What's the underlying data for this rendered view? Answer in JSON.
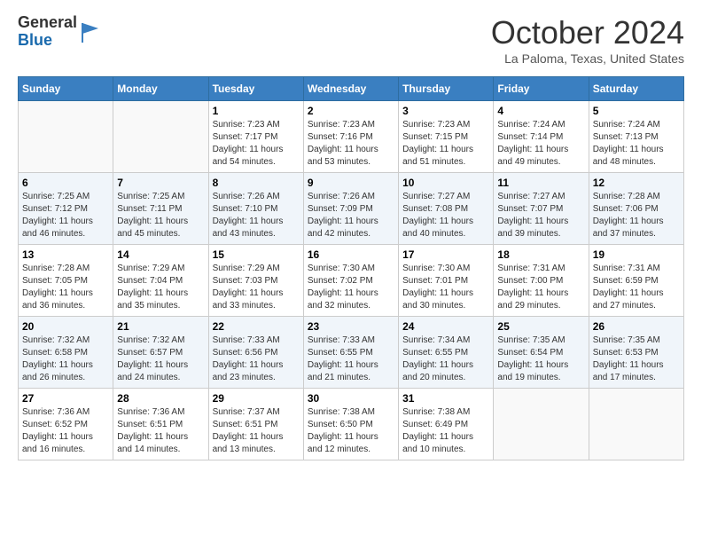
{
  "header": {
    "logo_general": "General",
    "logo_blue": "Blue",
    "month_title": "October 2024",
    "location": "La Paloma, Texas, United States"
  },
  "weekdays": [
    "Sunday",
    "Monday",
    "Tuesday",
    "Wednesday",
    "Thursday",
    "Friday",
    "Saturday"
  ],
  "weeks": [
    [
      {
        "day": "",
        "sunrise": "",
        "sunset": "",
        "daylight": ""
      },
      {
        "day": "",
        "sunrise": "",
        "sunset": "",
        "daylight": ""
      },
      {
        "day": "1",
        "sunrise": "Sunrise: 7:23 AM",
        "sunset": "Sunset: 7:17 PM",
        "daylight": "Daylight: 11 hours and 54 minutes."
      },
      {
        "day": "2",
        "sunrise": "Sunrise: 7:23 AM",
        "sunset": "Sunset: 7:16 PM",
        "daylight": "Daylight: 11 hours and 53 minutes."
      },
      {
        "day": "3",
        "sunrise": "Sunrise: 7:23 AM",
        "sunset": "Sunset: 7:15 PM",
        "daylight": "Daylight: 11 hours and 51 minutes."
      },
      {
        "day": "4",
        "sunrise": "Sunrise: 7:24 AM",
        "sunset": "Sunset: 7:14 PM",
        "daylight": "Daylight: 11 hours and 49 minutes."
      },
      {
        "day": "5",
        "sunrise": "Sunrise: 7:24 AM",
        "sunset": "Sunset: 7:13 PM",
        "daylight": "Daylight: 11 hours and 48 minutes."
      }
    ],
    [
      {
        "day": "6",
        "sunrise": "Sunrise: 7:25 AM",
        "sunset": "Sunset: 7:12 PM",
        "daylight": "Daylight: 11 hours and 46 minutes."
      },
      {
        "day": "7",
        "sunrise": "Sunrise: 7:25 AM",
        "sunset": "Sunset: 7:11 PM",
        "daylight": "Daylight: 11 hours and 45 minutes."
      },
      {
        "day": "8",
        "sunrise": "Sunrise: 7:26 AM",
        "sunset": "Sunset: 7:10 PM",
        "daylight": "Daylight: 11 hours and 43 minutes."
      },
      {
        "day": "9",
        "sunrise": "Sunrise: 7:26 AM",
        "sunset": "Sunset: 7:09 PM",
        "daylight": "Daylight: 11 hours and 42 minutes."
      },
      {
        "day": "10",
        "sunrise": "Sunrise: 7:27 AM",
        "sunset": "Sunset: 7:08 PM",
        "daylight": "Daylight: 11 hours and 40 minutes."
      },
      {
        "day": "11",
        "sunrise": "Sunrise: 7:27 AM",
        "sunset": "Sunset: 7:07 PM",
        "daylight": "Daylight: 11 hours and 39 minutes."
      },
      {
        "day": "12",
        "sunrise": "Sunrise: 7:28 AM",
        "sunset": "Sunset: 7:06 PM",
        "daylight": "Daylight: 11 hours and 37 minutes."
      }
    ],
    [
      {
        "day": "13",
        "sunrise": "Sunrise: 7:28 AM",
        "sunset": "Sunset: 7:05 PM",
        "daylight": "Daylight: 11 hours and 36 minutes."
      },
      {
        "day": "14",
        "sunrise": "Sunrise: 7:29 AM",
        "sunset": "Sunset: 7:04 PM",
        "daylight": "Daylight: 11 hours and 35 minutes."
      },
      {
        "day": "15",
        "sunrise": "Sunrise: 7:29 AM",
        "sunset": "Sunset: 7:03 PM",
        "daylight": "Daylight: 11 hours and 33 minutes."
      },
      {
        "day": "16",
        "sunrise": "Sunrise: 7:30 AM",
        "sunset": "Sunset: 7:02 PM",
        "daylight": "Daylight: 11 hours and 32 minutes."
      },
      {
        "day": "17",
        "sunrise": "Sunrise: 7:30 AM",
        "sunset": "Sunset: 7:01 PM",
        "daylight": "Daylight: 11 hours and 30 minutes."
      },
      {
        "day": "18",
        "sunrise": "Sunrise: 7:31 AM",
        "sunset": "Sunset: 7:00 PM",
        "daylight": "Daylight: 11 hours and 29 minutes."
      },
      {
        "day": "19",
        "sunrise": "Sunrise: 7:31 AM",
        "sunset": "Sunset: 6:59 PM",
        "daylight": "Daylight: 11 hours and 27 minutes."
      }
    ],
    [
      {
        "day": "20",
        "sunrise": "Sunrise: 7:32 AM",
        "sunset": "Sunset: 6:58 PM",
        "daylight": "Daylight: 11 hours and 26 minutes."
      },
      {
        "day": "21",
        "sunrise": "Sunrise: 7:32 AM",
        "sunset": "Sunset: 6:57 PM",
        "daylight": "Daylight: 11 hours and 24 minutes."
      },
      {
        "day": "22",
        "sunrise": "Sunrise: 7:33 AM",
        "sunset": "Sunset: 6:56 PM",
        "daylight": "Daylight: 11 hours and 23 minutes."
      },
      {
        "day": "23",
        "sunrise": "Sunrise: 7:33 AM",
        "sunset": "Sunset: 6:55 PM",
        "daylight": "Daylight: 11 hours and 21 minutes."
      },
      {
        "day": "24",
        "sunrise": "Sunrise: 7:34 AM",
        "sunset": "Sunset: 6:55 PM",
        "daylight": "Daylight: 11 hours and 20 minutes."
      },
      {
        "day": "25",
        "sunrise": "Sunrise: 7:35 AM",
        "sunset": "Sunset: 6:54 PM",
        "daylight": "Daylight: 11 hours and 19 minutes."
      },
      {
        "day": "26",
        "sunrise": "Sunrise: 7:35 AM",
        "sunset": "Sunset: 6:53 PM",
        "daylight": "Daylight: 11 hours and 17 minutes."
      }
    ],
    [
      {
        "day": "27",
        "sunrise": "Sunrise: 7:36 AM",
        "sunset": "Sunset: 6:52 PM",
        "daylight": "Daylight: 11 hours and 16 minutes."
      },
      {
        "day": "28",
        "sunrise": "Sunrise: 7:36 AM",
        "sunset": "Sunset: 6:51 PM",
        "daylight": "Daylight: 11 hours and 14 minutes."
      },
      {
        "day": "29",
        "sunrise": "Sunrise: 7:37 AM",
        "sunset": "Sunset: 6:51 PM",
        "daylight": "Daylight: 11 hours and 13 minutes."
      },
      {
        "day": "30",
        "sunrise": "Sunrise: 7:38 AM",
        "sunset": "Sunset: 6:50 PM",
        "daylight": "Daylight: 11 hours and 12 minutes."
      },
      {
        "day": "31",
        "sunrise": "Sunrise: 7:38 AM",
        "sunset": "Sunset: 6:49 PM",
        "daylight": "Daylight: 11 hours and 10 minutes."
      },
      {
        "day": "",
        "sunrise": "",
        "sunset": "",
        "daylight": ""
      },
      {
        "day": "",
        "sunrise": "",
        "sunset": "",
        "daylight": ""
      }
    ]
  ]
}
